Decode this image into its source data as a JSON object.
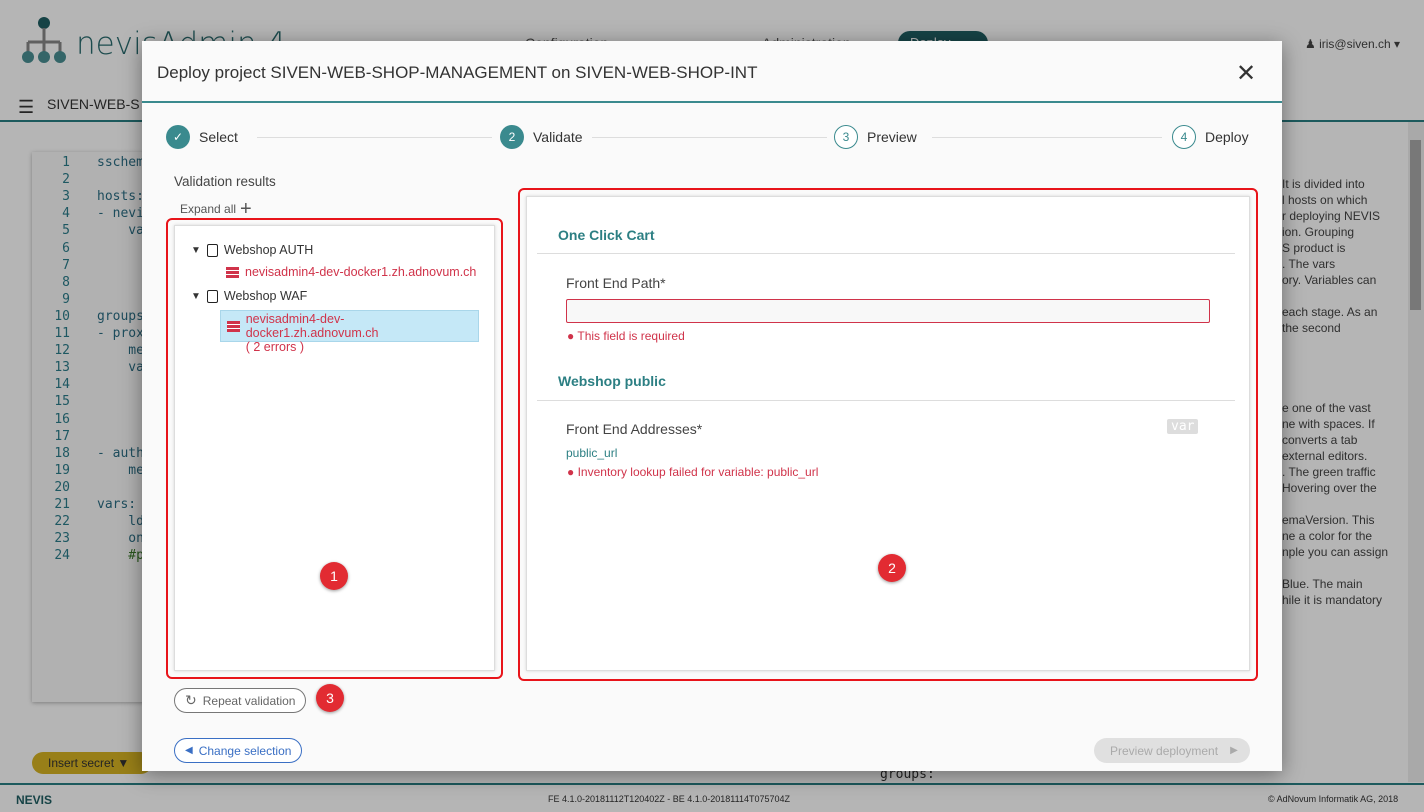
{
  "app": {
    "name": "nevisAdmin 4",
    "nav": [
      "Configuration",
      "Administration"
    ],
    "deploy_nav": "Deploy",
    "user": "iris@siven.ch",
    "project": "SIVEN-WEB-S"
  },
  "editor": {
    "lines": [
      "1",
      "2",
      "3",
      "4",
      "5",
      "6",
      "7",
      "8",
      "9",
      "10",
      "11",
      "12",
      "13",
      "14",
      "15",
      "16",
      "17",
      "18",
      "19",
      "20",
      "21",
      "22",
      "23",
      "24"
    ],
    "code": [
      "sschem",
      "",
      "hosts:",
      "- nevi",
      "    va",
      "",
      "",
      "",
      "",
      "groups",
      "- prox",
      "    me",
      "    va",
      "",
      "",
      "",
      "",
      "- auth",
      "    me",
      "",
      "vars:",
      "    ld",
      "    on",
      "    #p"
    ]
  },
  "right_pane": {
    "lines": [
      "It is divided into",
      "l hosts on which",
      "r deploying NEVIS",
      "ion. Grouping",
      "S product is",
      ". The vars",
      "ory. Variables can",
      "",
      "each stage. As an",
      "the second",
      "",
      "",
      "",
      "",
      "e one of the vast",
      "ne with spaces. If",
      "converts a tab",
      "external editors.",
      ". The green traffic",
      "Hovering over the",
      "",
      "emaVersion. This",
      "ne a color for the",
      "nple you can assign",
      "",
      "Blue. The main",
      "hile it is mandatory"
    ]
  },
  "bottom": {
    "insert_secret": "Insert secret",
    "groups_code": "groups:"
  },
  "footer": {
    "logo": "NEVIS",
    "version": "FE 4.1.0-20181112T120402Z - BE 4.1.0-20181114T075704Z",
    "copyright": "© AdNovum Informatik AG, 2018"
  },
  "modal": {
    "title": "Deploy project SIVEN-WEB-SHOP-MANAGEMENT on SIVEN-WEB-SHOP-INT",
    "steps": [
      {
        "num": "✓",
        "label": "Select",
        "state": "done"
      },
      {
        "num": "2",
        "label": "Validate",
        "state": "active"
      },
      {
        "num": "3",
        "label": "Preview",
        "state": "pending"
      },
      {
        "num": "4",
        "label": "Deploy",
        "state": "pending"
      }
    ],
    "validation_results": "Validation results",
    "expand_all": "Expand all",
    "tree": [
      {
        "group": "Webshop AUTH",
        "host": "nevisadmin4-dev-docker1.zh.adnovum.ch",
        "errors": ""
      },
      {
        "group": "Webshop WAF",
        "host": "nevisadmin4-dev-docker1.zh.adnovum.ch",
        "errors": "( 2 errors )",
        "selected": true
      }
    ],
    "details": {
      "sections": [
        {
          "title": "One Click Cart",
          "field": "Front End Path*",
          "value": "",
          "error": "This field is required"
        },
        {
          "title": "Webshop public",
          "field": "Front End Addresses*",
          "var_badge": "var",
          "value": "public_url",
          "error": "Inventory lookup failed for variable: public_url"
        }
      ]
    },
    "repeat_validation": "Repeat validation",
    "change_selection": "Change selection",
    "preview_deployment": "Preview deployment",
    "annotations": [
      "1",
      "2",
      "3"
    ]
  },
  "colors": {
    "accent": "#3a8a8e",
    "error": "#d0334a",
    "highlight": "#e8141a",
    "selected": "#c5e8f7"
  }
}
